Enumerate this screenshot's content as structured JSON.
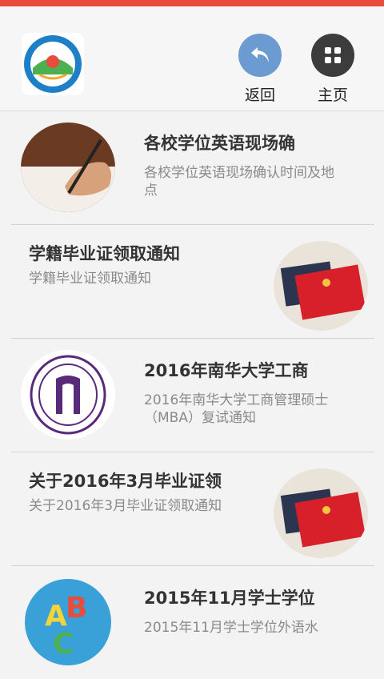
{
  "header": {
    "back_label": "返回",
    "home_label": "主页",
    "accent_color": "#e84c3d",
    "back_icon": "undo-arrow-icon",
    "home_icon": "grid-icon"
  },
  "news": [
    {
      "title": "各校学位英语现场确",
      "desc": "各校学位英语现场确认时间及地点"
    },
    {
      "title": "学籍毕业证领取通知",
      "desc": "学籍毕业证领取通知"
    },
    {
      "title": "2016年南华大学工商",
      "desc": "2016年南华大学工商管理硕士（MBA）复试通知"
    },
    {
      "title": "关于2016年3月毕业证领",
      "desc": "关于2016年3月毕业证领取通知"
    },
    {
      "title": "2015年11月学士学位",
      "desc": "2015年11月学士学位外语水"
    }
  ]
}
